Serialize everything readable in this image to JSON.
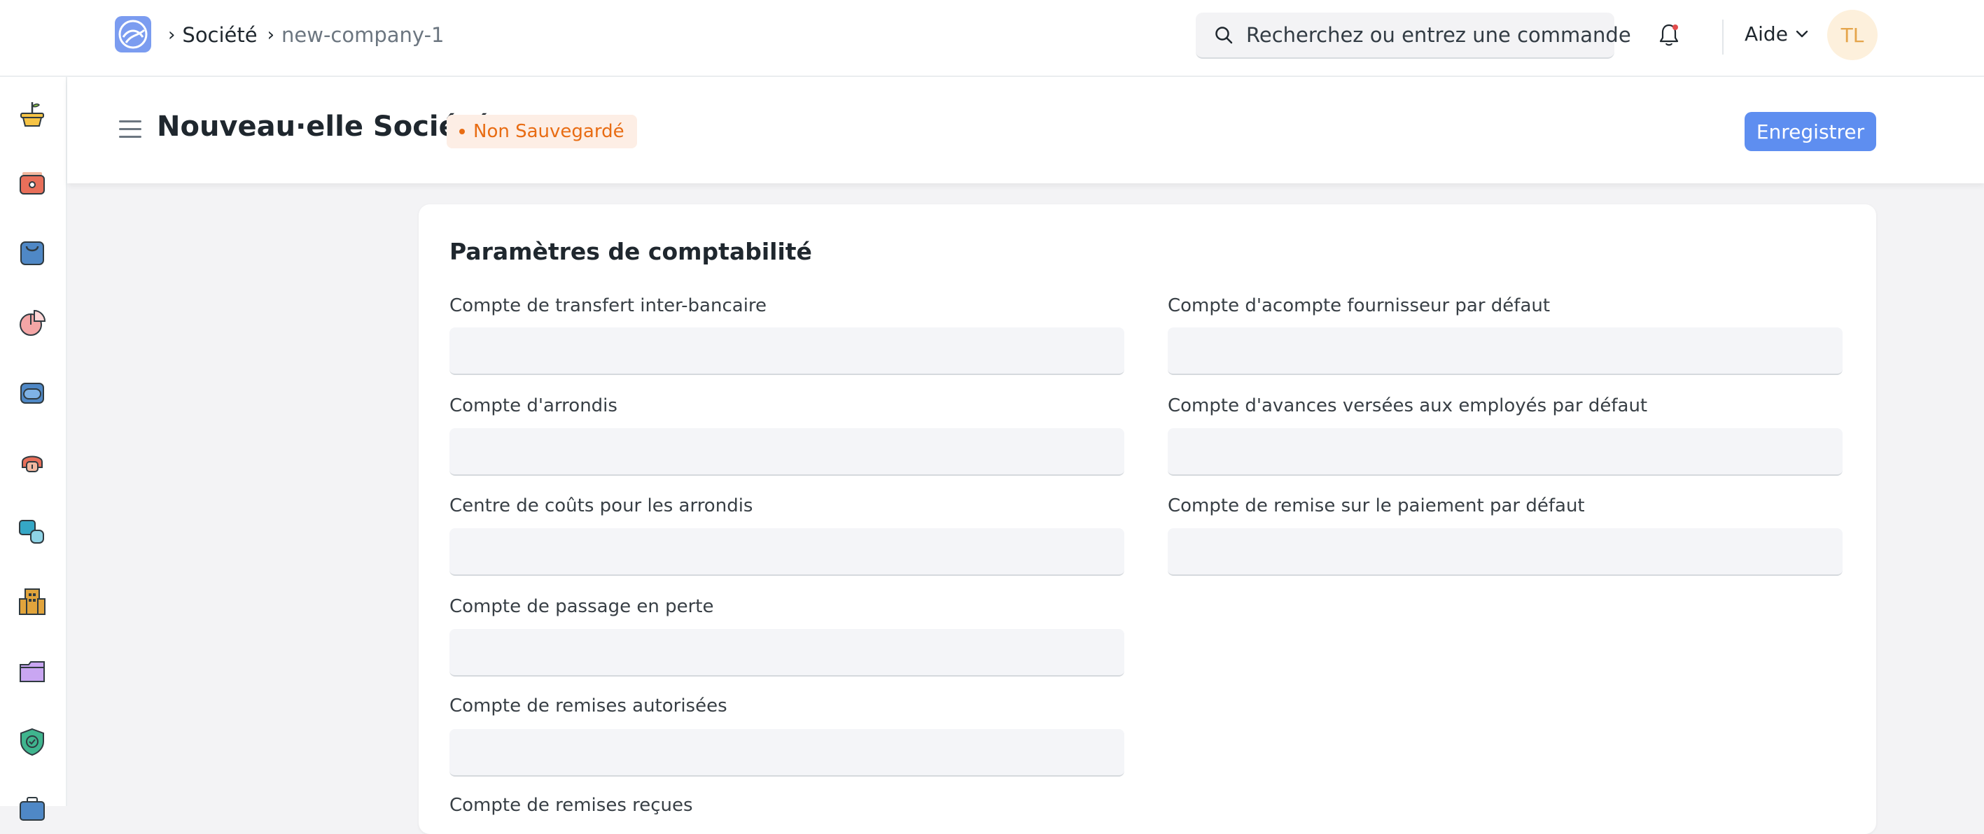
{
  "navbar": {
    "breadcrumbs": [
      "Société",
      "new-company-1"
    ],
    "search_placeholder": "Recherchez ou entrez une commande",
    "help_label": "Aide",
    "avatar_initials": "TL",
    "logo_color": "#7b9cf0"
  },
  "sidebar": {
    "icons": [
      "plant-pot-icon",
      "wallet-icon",
      "shopping-bag-icon",
      "pie-chart-icon",
      "stack-icon",
      "support-icon",
      "assets-icon",
      "building-icon",
      "folder-icon",
      "shield-check-icon",
      "briefcase-icon"
    ]
  },
  "page": {
    "title": "Nouveau·elle Société",
    "status": "Non Sauvegardé",
    "save_label": "Enregistrer",
    "accent_color": "#5e8ef0",
    "status_color": "#e86c13"
  },
  "form": {
    "section_title": "Paramètres de comptabilité",
    "left_fields": [
      {
        "label": "Compte de transfert inter-bancaire",
        "value": ""
      },
      {
        "label": "Compte d'arrondis",
        "value": ""
      },
      {
        "label": "Centre de coûts pour les arrondis",
        "value": ""
      },
      {
        "label": "Compte de passage en perte",
        "value": ""
      },
      {
        "label": "Compte de remises autorisées",
        "value": ""
      },
      {
        "label": "Compte de remises reçues",
        "value": ""
      }
    ],
    "right_fields": [
      {
        "label": "Compte d'acompte fournisseur par défaut",
        "value": ""
      },
      {
        "label": "Compte d'avances versées aux employés par défaut",
        "value": ""
      },
      {
        "label": "Compte de remise sur le paiement par défaut",
        "value": ""
      }
    ]
  }
}
